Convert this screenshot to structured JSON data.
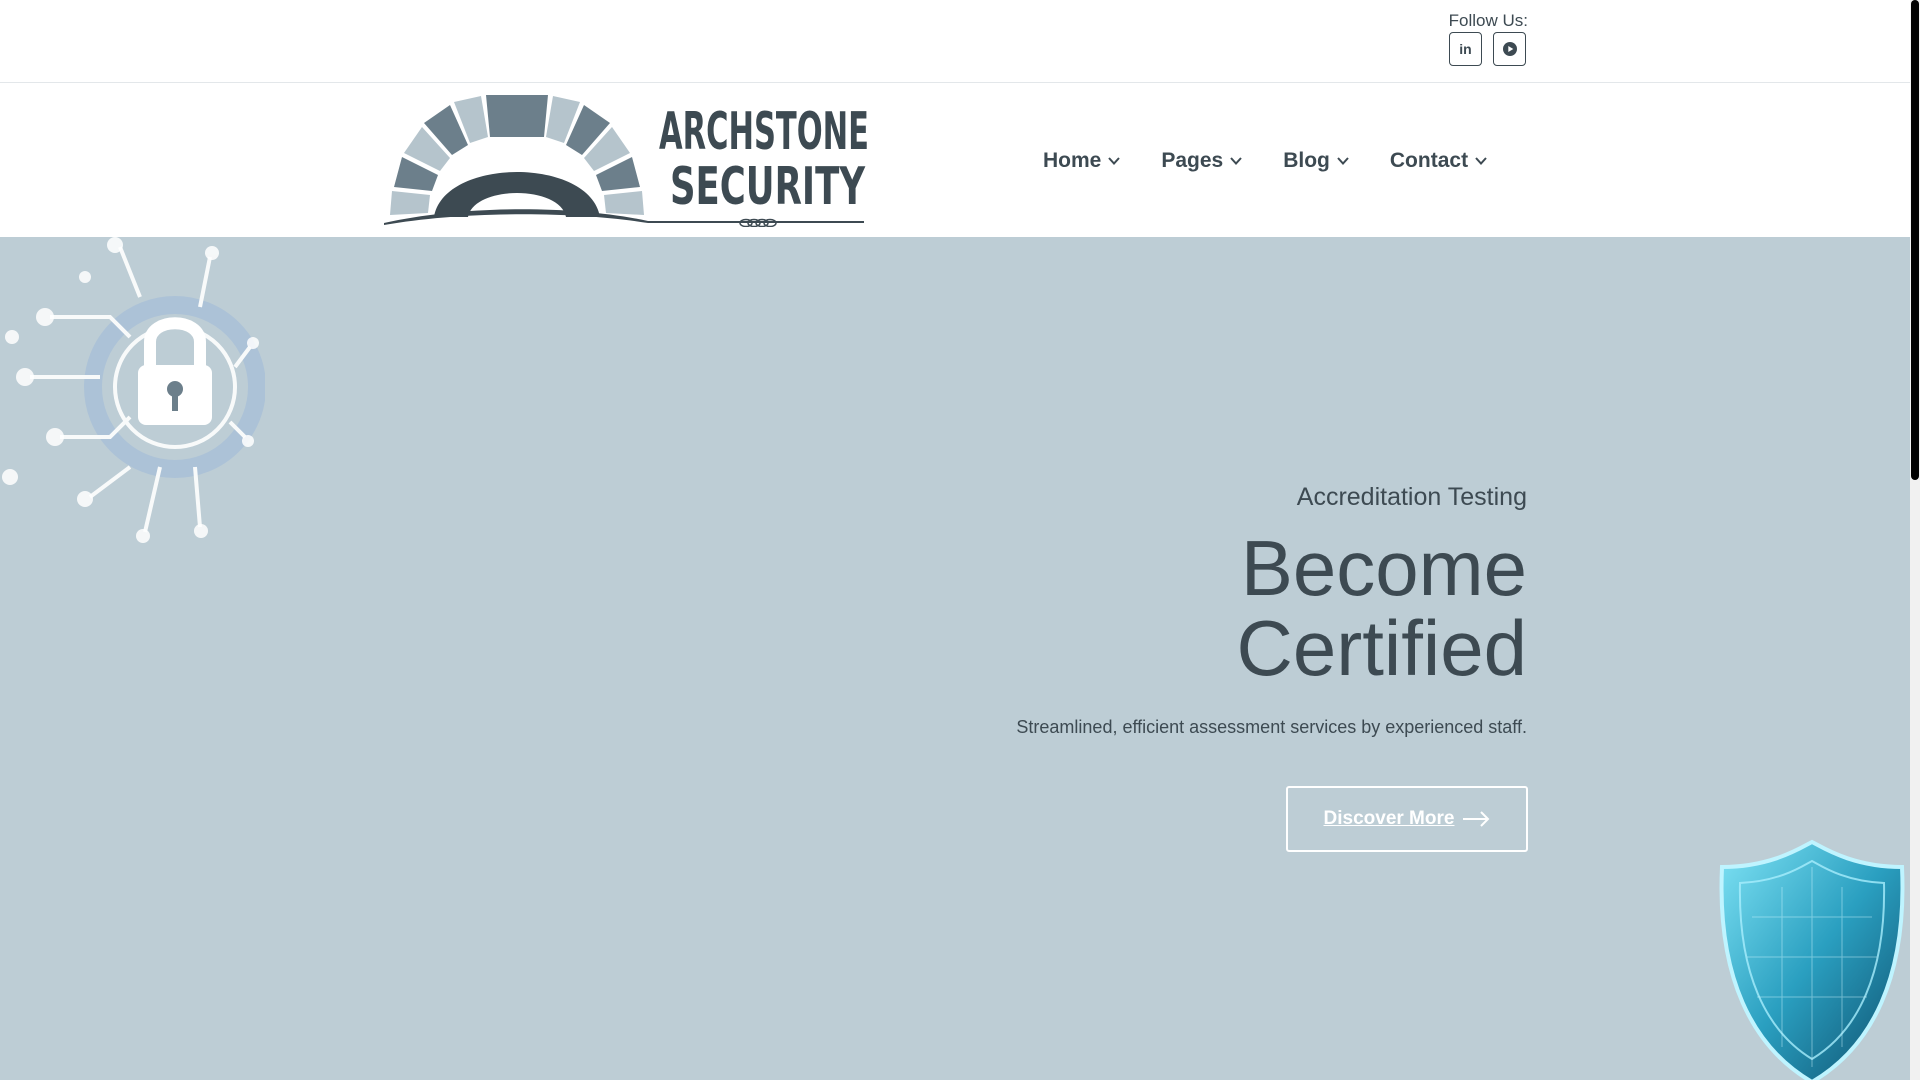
{
  "topbar": {
    "follow_label": "Follow Us:",
    "social": [
      {
        "name": "linkedin-icon",
        "glyph": "in"
      },
      {
        "name": "youtube-icon"
      }
    ]
  },
  "brand": {
    "line1": "ARCHSTONE",
    "line2": "SECURITY",
    "colors": {
      "dark": "#3d4a52",
      "mid": "#6c7f8b",
      "light": "#b5c4cc"
    }
  },
  "nav": {
    "items": [
      {
        "label": "Home"
      },
      {
        "label": "Pages"
      },
      {
        "label": "Blog"
      },
      {
        "label": "Contact"
      }
    ]
  },
  "hero": {
    "eyebrow": "Accreditation Testing",
    "headline_line1": "Become",
    "headline_line2": "Certified",
    "subtext": "Streamlined, efficient assessment services by experienced staff.",
    "cta_label": "Discover More",
    "background": "#bdcdd5"
  }
}
